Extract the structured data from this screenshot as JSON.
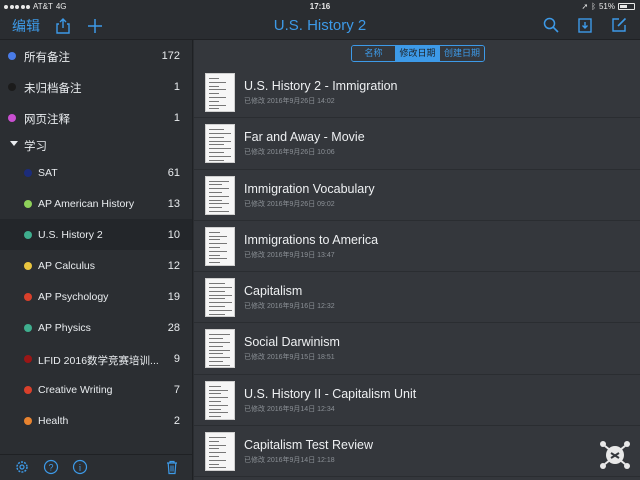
{
  "status": {
    "carrier": "AT&T",
    "network": "4G",
    "time": "17:16",
    "battery": "51%"
  },
  "nav": {
    "edit_label": "编辑",
    "title": "U.S. History 2"
  },
  "sidebar": {
    "top_items": [
      {
        "label": "所有备注",
        "count": "172",
        "color": "#4a7ce8"
      },
      {
        "label": "未归档备注",
        "count": "1",
        "color": "#1b1b1b"
      },
      {
        "label": "网页注释",
        "count": "1",
        "color": "#c94fd1"
      }
    ],
    "group_label": "学习",
    "notebooks": [
      {
        "label": "SAT",
        "count": "61",
        "color": "#1c2c7a"
      },
      {
        "label": "AP American History",
        "count": "13",
        "color": "#8ed15a"
      },
      {
        "label": "U.S. History 2",
        "count": "10",
        "color": "#3fae8e"
      },
      {
        "label": "AP Calculus",
        "count": "12",
        "color": "#e9c53f"
      },
      {
        "label": "AP Psychology",
        "count": "19",
        "color": "#d9402b"
      },
      {
        "label": "AP Physics",
        "count": "28",
        "color": "#3fae8e"
      },
      {
        "label": "LFID 2016数学竞赛培训...",
        "count": "9",
        "color": "#9b1616"
      },
      {
        "label": "Creative Writing",
        "count": "7",
        "color": "#d9402b"
      },
      {
        "label": "Health",
        "count": "2",
        "color": "#e8832f"
      }
    ]
  },
  "sort": {
    "options": [
      "名称",
      "修改日期",
      "创建日期"
    ],
    "active_index": 1
  },
  "notes": [
    {
      "title": "U.S. History 2 - Immigration",
      "date": "已修改 2016年9月26日 14:02"
    },
    {
      "title": "Far and Away - Movie",
      "date": "已修改 2016年9月26日 10:06"
    },
    {
      "title": "Immigration Vocabulary",
      "date": "已修改 2016年9月26日 09:02"
    },
    {
      "title": "Immigrations to America",
      "date": "已修改 2016年9月19日 13:47"
    },
    {
      "title": "Capitalism",
      "date": "已修改 2016年9月16日 12:32"
    },
    {
      "title": "Social Darwinism",
      "date": "已修改 2016年9月15日 18:51"
    },
    {
      "title": "U.S. History II - Capitalism Unit",
      "date": "已修改 2016年9月14日 12:34"
    },
    {
      "title": "Capitalism Test Review",
      "date": "已修改 2016年9月14日 12:18"
    }
  ],
  "colors": {
    "accent": "#3d9ae8",
    "sidebar_bg": "#2b2e32",
    "main_bg": "#34373c"
  }
}
